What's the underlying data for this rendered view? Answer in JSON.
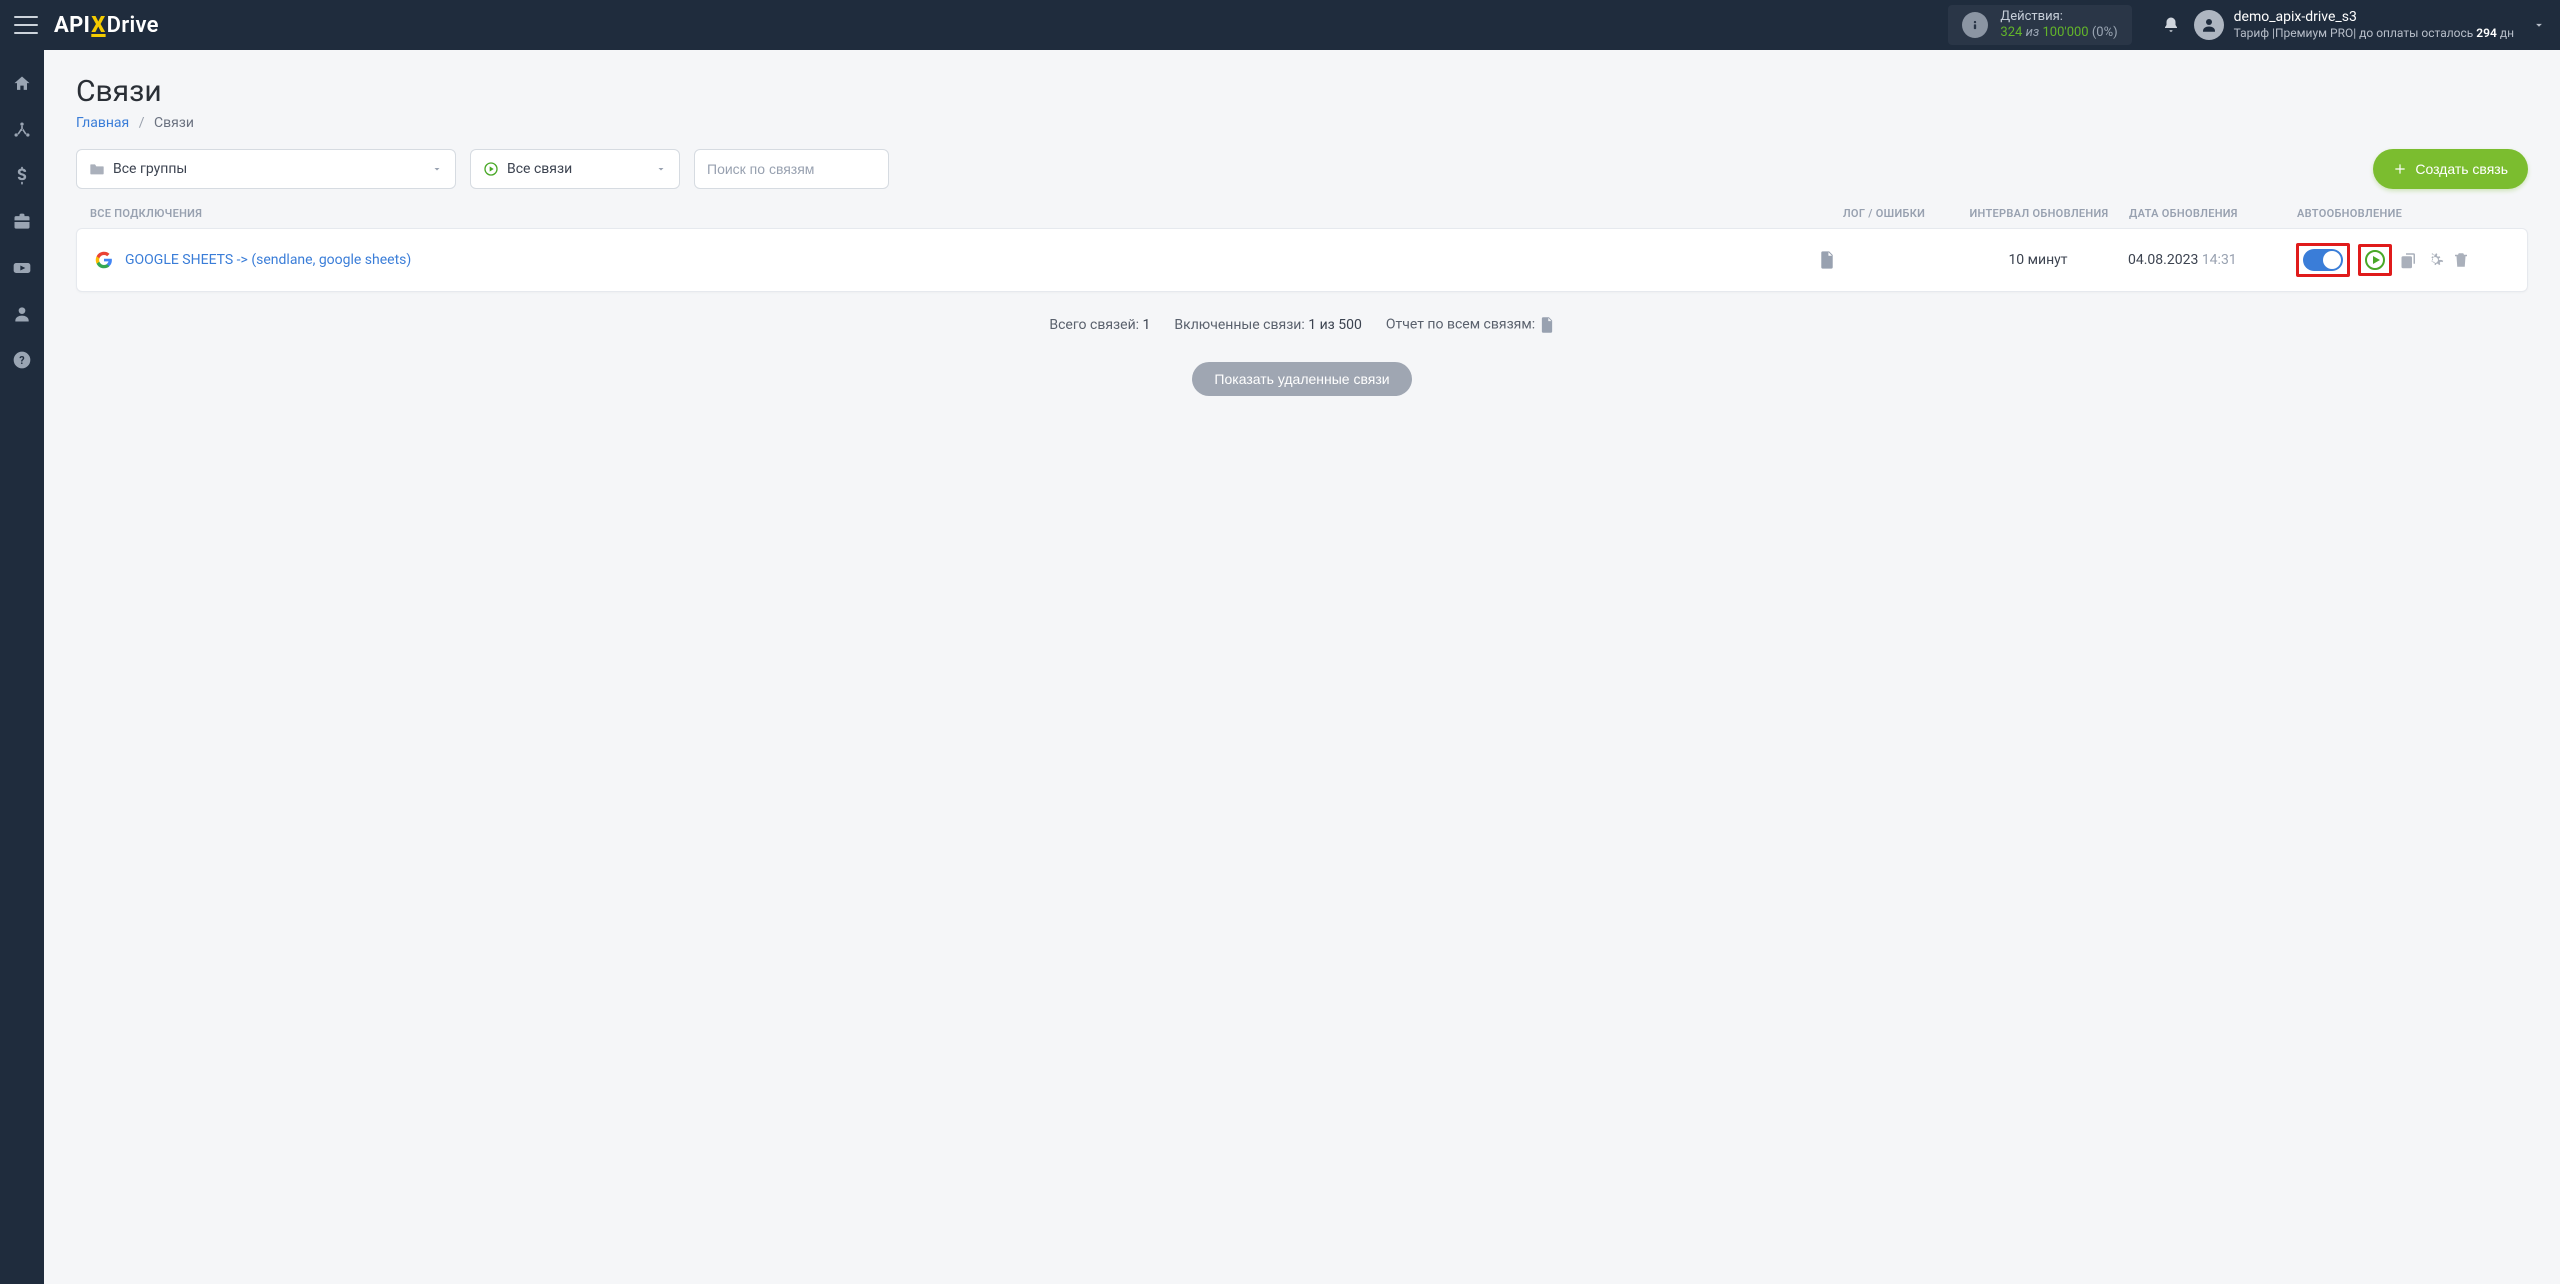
{
  "header": {
    "logo": {
      "api": "API",
      "x": "X",
      "drive": "Drive"
    },
    "actions": {
      "label": "Действия:",
      "used": "324",
      "iz": "из",
      "total": "100'000",
      "pct": "(0%)"
    },
    "user": {
      "name": "demo_apix-drive_s3",
      "tariff_prefix": "Тариф |Премиум PRO| до оплаты осталось ",
      "days_bold": "294",
      "days_suffix": " дн"
    }
  },
  "page": {
    "title": "Связи",
    "breadcrumb_home": "Главная",
    "breadcrumb_current": "Связи"
  },
  "controls": {
    "groups_label": "Все группы",
    "status_label": "Все связи",
    "search_placeholder": "Поиск по связям",
    "create_label": "Создать связь"
  },
  "table": {
    "head": {
      "name": "ВСЕ ПОДКЛЮЧЕНИЯ",
      "log": "ЛОГ / ОШИБКИ",
      "interval": "ИНТЕРВАЛ ОБНОВЛЕНИЯ",
      "date": "ДАТА ОБНОВЛЕНИЯ",
      "auto": "АВТООБНОВЛЕНИЕ"
    },
    "row": {
      "name": "GOOGLE SHEETS -> (sendlane, google sheets)",
      "interval": "10 минут",
      "date": "04.08.2023",
      "time": "14:31"
    }
  },
  "summary": {
    "total_label": "Всего связей:",
    "total_value": "1",
    "enabled_label": "Включенные связи:",
    "enabled_value": "1 из 500",
    "report_label": "Отчет по всем связям:"
  },
  "show_deleted": "Показать удаленные связи"
}
